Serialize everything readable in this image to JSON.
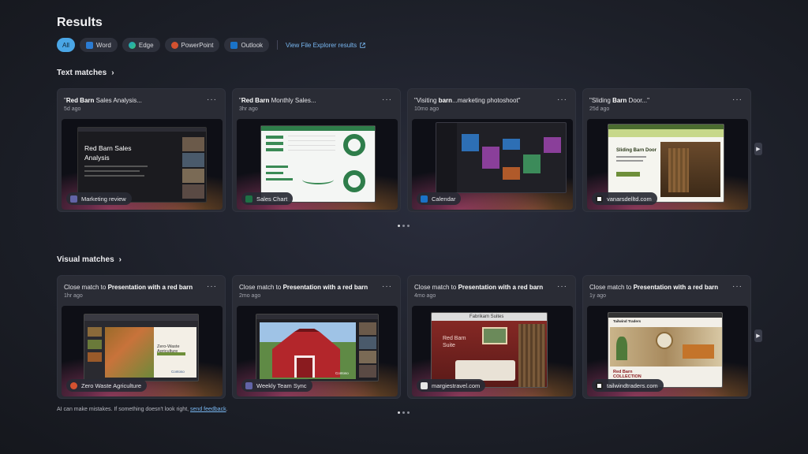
{
  "page": {
    "title": "Results"
  },
  "filters": {
    "items": [
      {
        "label": "All",
        "active": true
      },
      {
        "label": "Word",
        "icon": "word-icon",
        "color": "#2b7cd3"
      },
      {
        "label": "Edge",
        "icon": "edge-icon",
        "color": "#1fa3c4"
      },
      {
        "label": "PowerPoint",
        "icon": "powerpoint-icon",
        "color": "#d35230"
      },
      {
        "label": "Outlook",
        "icon": "outlook-icon",
        "color": "#1a73c8"
      }
    ],
    "file_explorer_link": "View File Explorer results"
  },
  "text_matches": {
    "heading": "Text matches",
    "cards": [
      {
        "title_bold": "Red Barn",
        "title_rest": " Sales Analysis...",
        "title_prefix": "\"",
        "time": "5d ago",
        "source": "Marketing review",
        "source_icon": "teams-icon",
        "slide_title": "Red Barn Sales Analysis"
      },
      {
        "title_bold": "Red Barn",
        "title_rest": " Monthly Sales...",
        "title_prefix": "\"",
        "time": "3hr ago",
        "source": "Sales Chart",
        "source_icon": "excel-icon"
      },
      {
        "title_bold": "barn",
        "title_rest": "...marketing photoshoot\"",
        "title_prefix": "\"Visiting ",
        "time": "10mo ago",
        "source": "Calendar",
        "source_icon": "calendar-icon"
      },
      {
        "title_bold": "Barn",
        "title_rest": " Door...\"",
        "title_prefix": "\"Sliding ",
        "time": "25d ago",
        "source": "vanarsdelltd.com",
        "source_icon": "website-icon",
        "site_heading": "Sliding Barn Door"
      }
    ]
  },
  "visual_matches": {
    "heading": "Visual matches",
    "cards": [
      {
        "title_plain": "Close match to ",
        "title_bold": "Presentation with a red barn",
        "time": "1hr ago",
        "source": "Zero Waste Agriculture",
        "source_icon": "powerpoint-icon",
        "slide_text": "Zero-Waste Agriculture",
        "brand": "Contoso"
      },
      {
        "title_plain": "Close match to ",
        "title_bold": "Presentation with a red barn",
        "time": "2mo ago",
        "source": "Weekly Team Sync",
        "source_icon": "teams-icon",
        "brand": "Contoso"
      },
      {
        "title_plain": "Close match to ",
        "title_bold": "Presentation with a red barn",
        "time": "4mo ago",
        "source": "margiestravel.com",
        "source_icon": "website-icon",
        "site_heading": "Fabrikam Suites",
        "overlay_text": "Red Barn Suite"
      },
      {
        "title_plain": "Close match to ",
        "title_bold": "Presentation with a red barn",
        "time": "1y ago",
        "source": "tailwindtraders.com",
        "source_icon": "website-icon",
        "site_heading": "Tailwind Traders",
        "overlay_text": "Red Barn COLLECTION"
      }
    ]
  },
  "footer": {
    "text": "AI can make mistakes. If something doesn't look right, ",
    "link": "send feedback",
    "period": "."
  },
  "colors": {
    "accent": "#4aa6e6",
    "link": "#79b8f2",
    "barn_red": "#b3262b"
  }
}
